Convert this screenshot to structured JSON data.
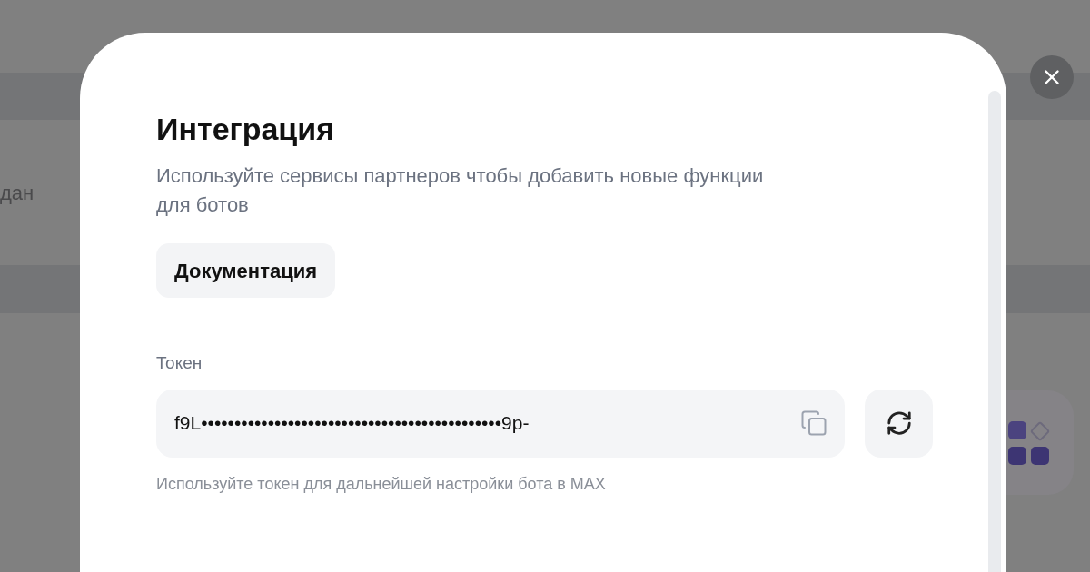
{
  "background": {
    "row_text": "дан"
  },
  "dialog": {
    "title": "Интеграция",
    "description": "Используйте сервисы партнеров чтобы добавить новые функции для ботов",
    "docs_button": "Документация",
    "token": {
      "label": "Токен",
      "value": "f9L•••••••••••••••••••••••••••••••••••••••••••••9p-",
      "hint": "Используйте токен для дальнейшей настройки бота в MAX"
    }
  }
}
